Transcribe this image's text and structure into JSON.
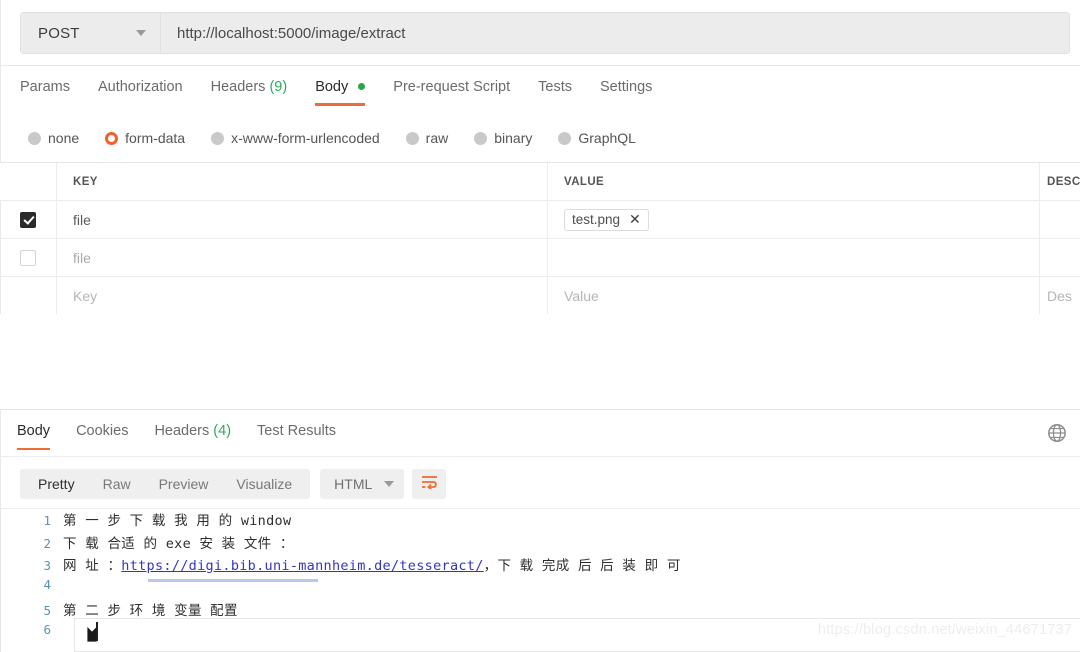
{
  "request": {
    "method": "POST",
    "method_icon": "chevron-down-icon",
    "url": "http://localhost:5000/image/extract",
    "tabs": [
      {
        "label": "Params",
        "active": false
      },
      {
        "label": "Authorization",
        "active": false
      },
      {
        "label": "Headers",
        "count": "(9)",
        "active": false
      },
      {
        "label": "Body",
        "active": true,
        "dot": true
      },
      {
        "label": "Pre-request Script",
        "active": false
      },
      {
        "label": "Tests",
        "active": false
      },
      {
        "label": "Settings",
        "active": false
      }
    ],
    "body_types": [
      {
        "label": "none",
        "selected": false
      },
      {
        "label": "form-data",
        "selected": true
      },
      {
        "label": "x-www-form-urlencoded",
        "selected": false
      },
      {
        "label": "raw",
        "selected": false
      },
      {
        "label": "binary",
        "selected": false
      },
      {
        "label": "GraphQL",
        "selected": false
      }
    ],
    "table": {
      "headers": {
        "key": "KEY",
        "value": "VALUE",
        "description": "DESC"
      },
      "rows": [
        {
          "checked": true,
          "key": "file",
          "value_chip": "test.png",
          "chip_remove": "✕",
          "description": ""
        },
        {
          "checked": false,
          "key": "file",
          "value_chip": "",
          "description": ""
        }
      ],
      "placeholder_row": {
        "key": "Key",
        "value": "Value",
        "description": "Des"
      }
    }
  },
  "response": {
    "tabs": [
      {
        "label": "Body",
        "active": true
      },
      {
        "label": "Cookies",
        "active": false
      },
      {
        "label": "Headers",
        "count": "(4)",
        "active": false
      },
      {
        "label": "Test Results",
        "active": false
      }
    ],
    "globe_icon": "globe-icon",
    "format_buttons": [
      {
        "label": "Pretty",
        "active": true
      },
      {
        "label": "Raw",
        "active": false
      },
      {
        "label": "Preview",
        "active": false
      },
      {
        "label": "Visualize",
        "active": false
      }
    ],
    "language": "HTML",
    "language_icon": "chevron-down-icon",
    "wrap_icon": "wrap-lines-icon",
    "code_lines": [
      {
        "no": "1",
        "text": "第 一 步 下 载 我 用 的 window"
      },
      {
        "no": "2",
        "text": "下 载 合适 的 exe 安 装 文件 ："
      },
      {
        "no": "3",
        "prefix": "网 址 ：",
        "link": "https://digi.bib.uni-mannheim.de/tesseract/",
        "suffix": "，下 载 完成 后 后 装 即 可"
      },
      {
        "no": "4",
        "text": ""
      },
      {
        "no": "5",
        "text": "第 二 步 环 境 变量 配置"
      },
      {
        "no": "6",
        "text": "",
        "cursor": "mouse-pointer-icon"
      }
    ]
  },
  "watermark": "https://blog.csdn.net/weixin_44671737",
  "colors": {
    "accent": "#ef6c36",
    "green": "#2bab5e",
    "link": "#3333cc",
    "line_number": "#5b93ac"
  }
}
